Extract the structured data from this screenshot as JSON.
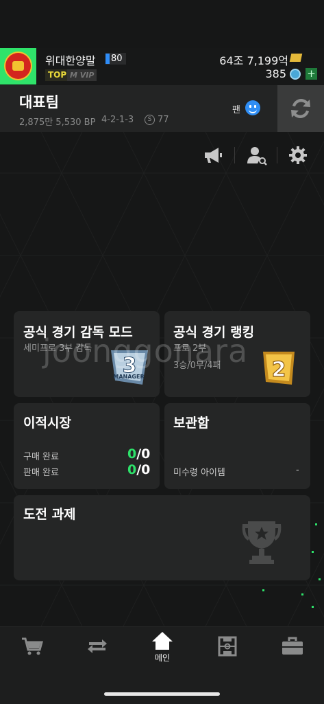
{
  "profile": {
    "username": "위대한양말",
    "level": "80",
    "badge_top": "TOP",
    "badge_vip": "M VIP",
    "money": "64조 7,199억",
    "coins": "385",
    "plus": "+"
  },
  "team": {
    "name": "대표팀",
    "bp": "2,875만 5,530 BP",
    "formation": "4-2-1-3",
    "skill_icon": "S",
    "skill_value": "77",
    "fan_label": "팬"
  },
  "cards": {
    "manager_mode": {
      "title": "공식 경기 감독 모드",
      "subtitle": "세미프로 3부 감독",
      "badge_text": "3",
      "badge_sub": "MANAGER"
    },
    "ranking": {
      "title": "공식 경기 랭킹",
      "subtitle": "프로 2부",
      "record": "3승/0무/4패",
      "badge_text": "2"
    },
    "transfer": {
      "title": "이적시장",
      "buy_label": "구매 완료",
      "buy_done": "0",
      "buy_total": "/0",
      "sell_label": "판매 완료",
      "sell_done": "0",
      "sell_total": "/0"
    },
    "storage": {
      "title": "보관함",
      "unclaimed_label": "미수령 아이템",
      "unclaimed_value": "-"
    },
    "challenge": {
      "title": "도전 과제"
    }
  },
  "watermark": "joonggonara",
  "nav": {
    "home_label": "메인"
  },
  "icons": [
    "megaphone-icon",
    "user-search-icon",
    "gear-icon",
    "swap-icon",
    "cart-icon",
    "transfer-arrows-icon",
    "home-icon",
    "pitch-icon",
    "briefcase-icon",
    "trophy-icon"
  ],
  "colors": {
    "accent_green": "#2de26a",
    "fan_blue": "#2f8ef5",
    "gold": "#e4b93a",
    "background": "#161717",
    "card": "#252626"
  }
}
